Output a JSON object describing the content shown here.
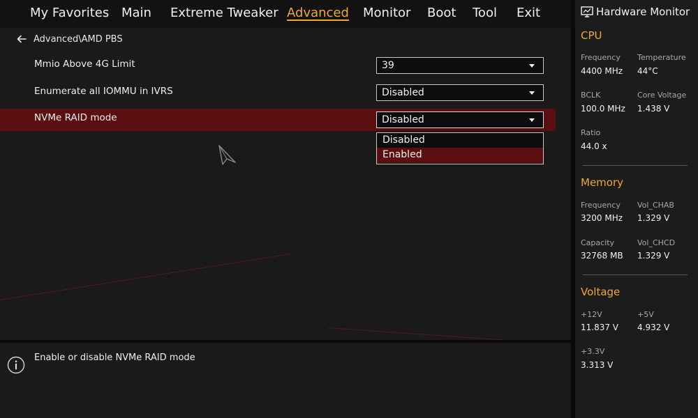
{
  "tabs": [
    {
      "label": "My Favorites",
      "active": false
    },
    {
      "label": "Main",
      "active": false
    },
    {
      "label": "Extreme Tweaker",
      "active": false
    },
    {
      "label": "Advanced",
      "active": true
    },
    {
      "label": "Monitor",
      "active": false
    },
    {
      "label": "Boot",
      "active": false
    },
    {
      "label": "Tool",
      "active": false
    },
    {
      "label": "Exit",
      "active": false
    }
  ],
  "breadcrumb": "Advanced\\AMD PBS",
  "settings": [
    {
      "label": "Mmio Above 4G Limit",
      "value": "39",
      "selected": false
    },
    {
      "label": "Enumerate all IOMMU in IVRS",
      "value": "Disabled",
      "selected": false
    },
    {
      "label": "NVMe RAID mode",
      "value": "Disabled",
      "selected": true
    }
  ],
  "dropdown": {
    "options": [
      "Disabled",
      "Enabled"
    ],
    "highlighted": "Enabled"
  },
  "help_text": "Enable or disable NVMe RAID mode",
  "hardware_monitor": {
    "title": "Hardware Monitor",
    "cpu": {
      "title": "CPU",
      "frequency_label": "Frequency",
      "frequency": "4400 MHz",
      "temperature_label": "Temperature",
      "temperature": "44°C",
      "bclk_label": "BCLK",
      "bclk": "100.0 MHz",
      "core_voltage_label": "Core Voltage",
      "core_voltage": "1.438 V",
      "ratio_label": "Ratio",
      "ratio": "44.0 x"
    },
    "memory": {
      "title": "Memory",
      "frequency_label": "Frequency",
      "frequency": "3200 MHz",
      "vol_chab_label": "Vol_CHAB",
      "vol_chab": "1.329 V",
      "capacity_label": "Capacity",
      "capacity": "32768 MB",
      "vol_chcd_label": "Vol_CHCD",
      "vol_chcd": "1.329 V"
    },
    "voltage": {
      "title": "Voltage",
      "v12_label": "+12V",
      "v12": "11.837 V",
      "v5_label": "+5V",
      "v5": "4.932 V",
      "v33_label": "+3.3V",
      "v33": "3.313 V"
    }
  },
  "colors": {
    "accent": "#f0a830",
    "selection": "#5a0e10",
    "panel": "#1a1a1a"
  },
  "icons": [
    "back-arrow-icon",
    "caret-down-icon",
    "info-icon",
    "monitor-icon",
    "mouse-cursor-icon"
  ]
}
